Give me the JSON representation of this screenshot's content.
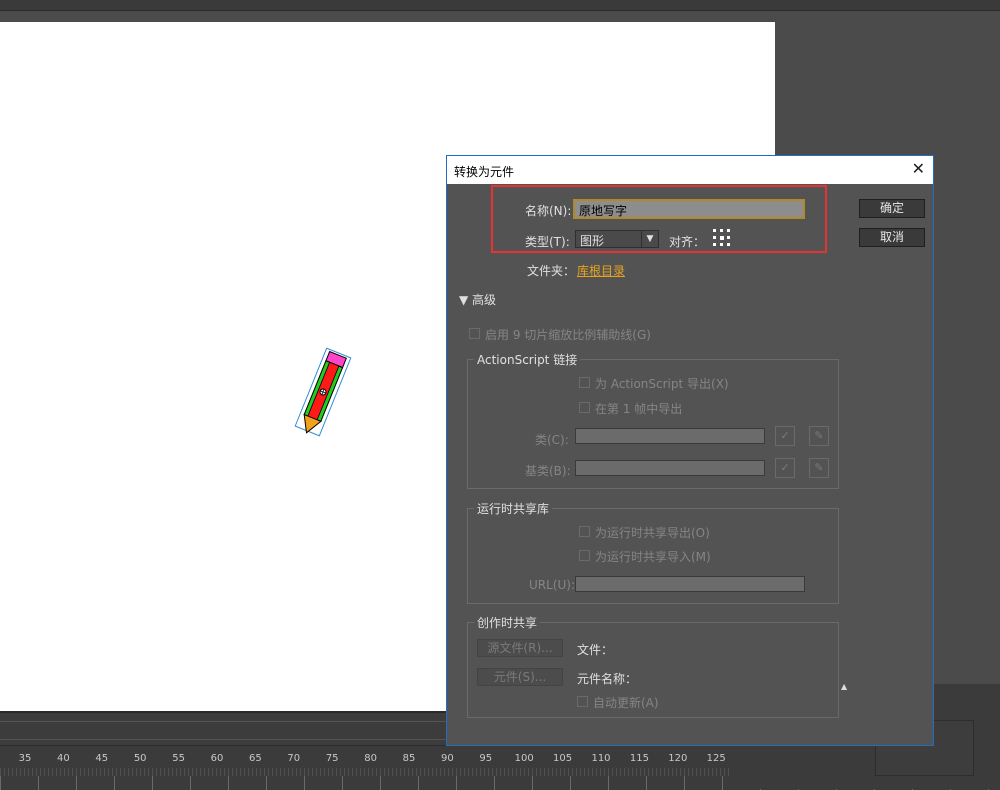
{
  "dialog": {
    "title": "转换为元件",
    "name_label": "名称(N):",
    "name_value": "原地写字",
    "type_label": "类型(T):",
    "type_value": "图形",
    "align_label": "对齐：",
    "folder_label": "文件夹：",
    "folder_value": "库根目录",
    "advanced_label": "▼ 高级",
    "ok_label": "确定",
    "cancel_label": "取消",
    "nine_slice_label": "启用 9 切片缩放比例辅助线(G)",
    "actionscript": {
      "group_title": "ActionScript 链接",
      "export_as_label": "为 ActionScript 导出(X)",
      "export_frame1_label": "在第 1 帧中导出",
      "class_label": "类(C):",
      "base_class_label": "基类(B):"
    },
    "runtime_sharing": {
      "group_title": "运行时共享库",
      "export_label": "为运行时共享导出(O)",
      "import_label": "为运行时共享导入(M)",
      "url_label": "URL(U):"
    },
    "authortime_sharing": {
      "group_title": "创作时共享",
      "source_file_button": "源文件(R)...",
      "file_label": "文件：",
      "symbol_button": "元件(S)...",
      "symbol_name_label": "元件名称：",
      "auto_update_label": "自动更新(A)"
    }
  },
  "timeline": {
    "ruler_numbers": [
      "35",
      "40",
      "45",
      "50",
      "55",
      "60",
      "65",
      "70",
      "75",
      "80",
      "85",
      "90",
      "95",
      "100",
      "105",
      "110",
      "115",
      "120",
      "125"
    ]
  },
  "colors": {
    "highlight_box": "#e53333",
    "link": "#e8a31e",
    "dialog_border": "#1f6fbf",
    "pencil_body": "#ff1a1a",
    "pencil_stripe": "#22cc22",
    "pencil_eraser": "#ff44cc",
    "pencil_tip": "#f2a11c"
  }
}
